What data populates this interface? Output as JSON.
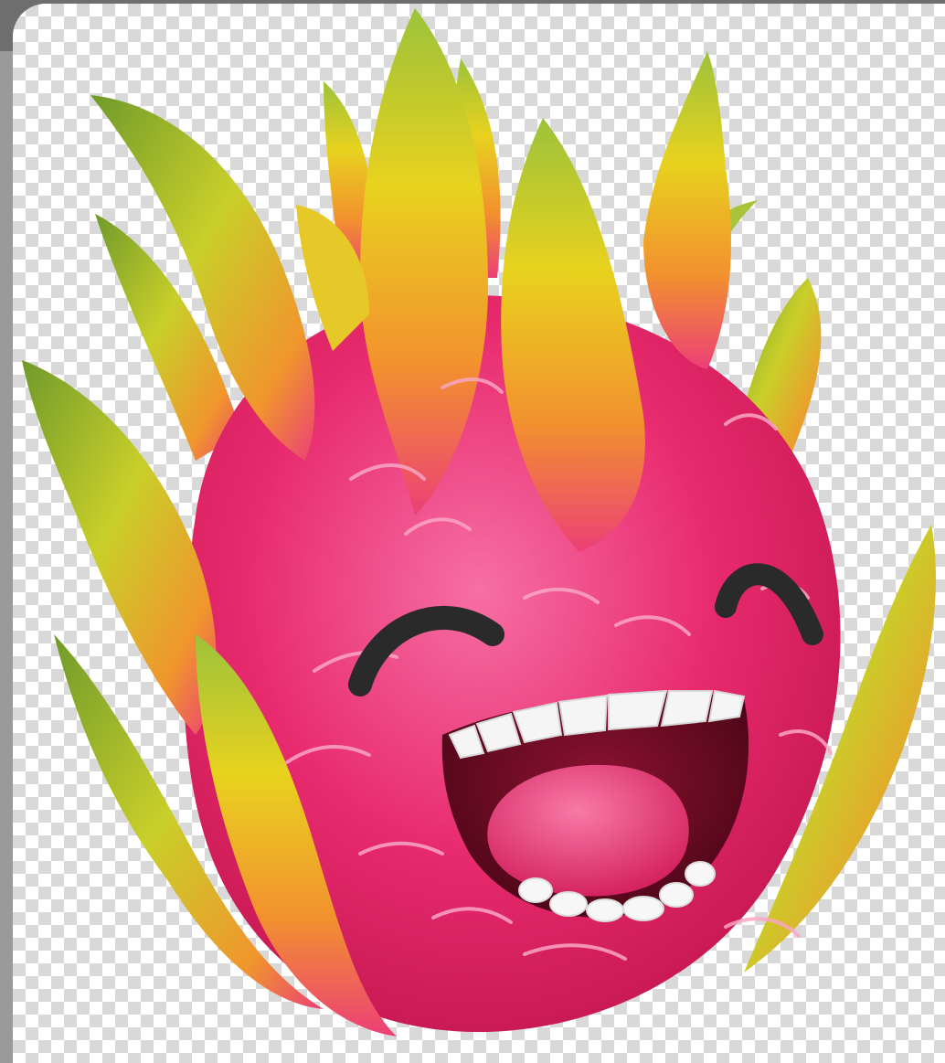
{
  "image": {
    "subject": "dragon-fruit-character",
    "background": "transparency-checkerboard",
    "colors": {
      "fruit_body": "#e8236b",
      "fruit_highlight": "#f56aa0",
      "leaf_green": "#7fae2e",
      "leaf_yellow": "#f0d21e",
      "leaf_orange": "#f08a2a",
      "eye_dark": "#2a2a2a",
      "mouth_inner": "#7a0c2a",
      "tongue": "#e8336c",
      "teeth": "#f7f7f7"
    }
  }
}
